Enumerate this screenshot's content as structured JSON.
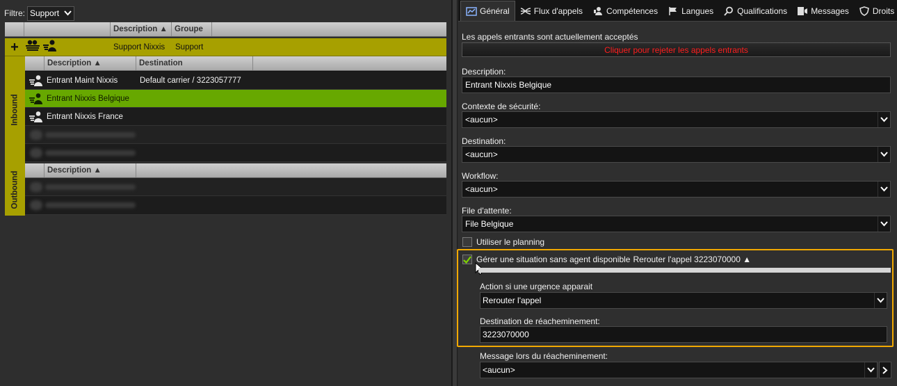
{
  "filter": {
    "label": "Filtre:",
    "value": "Support"
  },
  "top_grid": {
    "col_description": "Description ▲",
    "col_groupe": "Groupe"
  },
  "group_row": {
    "description": "Support Nixxis",
    "groupe": "Support"
  },
  "inbound": {
    "tab_label": "Inbound",
    "col_description": "Description ▲",
    "col_destination": "Destination",
    "rows": [
      {
        "description": "Entrant Maint Nixxis",
        "destination": "Default carrier / 3223057777"
      },
      {
        "description": "Entrant Nixxis Belgique",
        "destination": ""
      },
      {
        "description": "Entrant Nixxis France",
        "destination": ""
      }
    ]
  },
  "outbound": {
    "tab_label": "Outbound",
    "col_description": "Description ▲"
  },
  "tabs": [
    {
      "label": "Général",
      "icon": "chart-icon"
    },
    {
      "label": "Flux d'appels",
      "icon": "flow-icon"
    },
    {
      "label": "Compétences",
      "icon": "skills-icon"
    },
    {
      "label": "Langues",
      "icon": "flag-icon"
    },
    {
      "label": "Qualifications",
      "icon": "search-icon"
    },
    {
      "label": "Messages",
      "icon": "message-icon"
    },
    {
      "label": "Droits",
      "icon": "shield-icon"
    }
  ],
  "form": {
    "status_text": "Les appels entrants sont actuellement acceptés",
    "reject_button": "Cliquer pour rejeter les appels entrants",
    "description_label": "Description:",
    "description_value": "Entrant Nixxis Belgique",
    "security_label": "Contexte de sécurité:",
    "security_value": "<aucun>",
    "destination_label": "Destination:",
    "destination_value": "<aucun>",
    "workflow_label": "Workflow:",
    "workflow_value": "<aucun>",
    "queue_label": "File d'attente:",
    "queue_value": "File Belgique",
    "planning_label": "Utiliser le planning",
    "planning_checked": false,
    "no_agent_label": "Gérer une situation sans agent disponible",
    "no_agent_summary": "Rerouter l'appel 3223070000 ▲",
    "no_agent_checked": true,
    "action_label": "Action si une urgence apparait",
    "action_value": "Rerouter l'appel",
    "reroute_dest_label": "Destination de réacheminement:",
    "reroute_dest_value": "3223070000",
    "reroute_msg_label": "Message lors du réacheminement:",
    "reroute_msg_value": "<aucun>"
  },
  "colors": {
    "group_olive": "#a7a000",
    "selected_green": "#67a800",
    "reject_red": "#ff1e1e",
    "highlight_orange": "#f2a900"
  }
}
